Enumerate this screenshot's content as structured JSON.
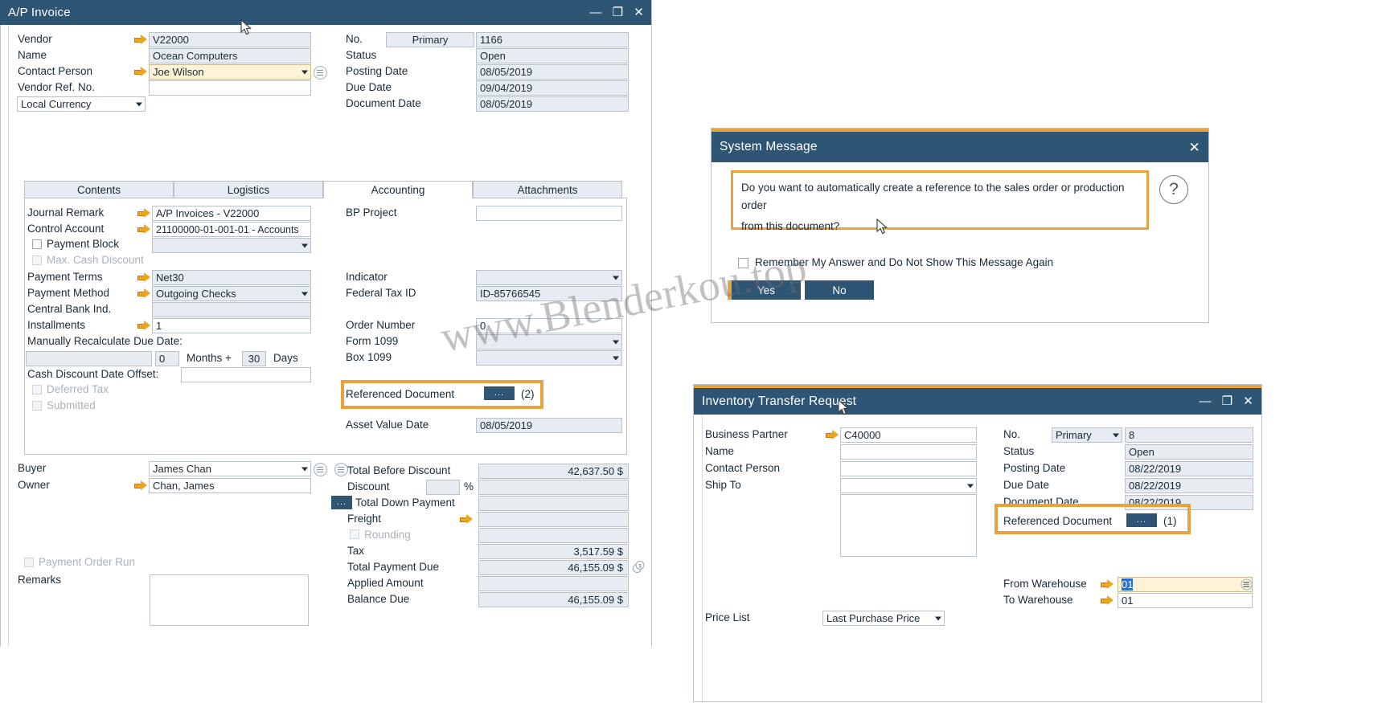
{
  "ap_invoice": {
    "title": "A/P Invoice",
    "window_buttons": {
      "minimize": "—",
      "maximize": "❐",
      "close": "✕"
    },
    "header_left": [
      {
        "label": "Vendor",
        "value": "V22000",
        "arrow": true
      },
      {
        "label": "Name",
        "value": "Ocean Computers",
        "arrow": false
      },
      {
        "label": "Contact Person",
        "value": "Joe Wilson",
        "arrow": true
      },
      {
        "label": "Vendor Ref. No.",
        "value": "",
        "arrow": false
      }
    ],
    "currency_select": "Local Currency",
    "header_right": [
      {
        "label": "No.",
        "series": "Primary",
        "value": "1166"
      },
      {
        "label": "Status",
        "value": "Open"
      },
      {
        "label": "Posting Date",
        "value": "08/05/2019"
      },
      {
        "label": "Due Date",
        "value": "09/04/2019"
      },
      {
        "label": "Document Date",
        "value": "08/05/2019"
      }
    ],
    "tabs": [
      {
        "label": "Contents",
        "active": false
      },
      {
        "label": "Logistics",
        "active": false
      },
      {
        "label": "Accounting",
        "active": true
      },
      {
        "label": "Attachments",
        "active": false
      }
    ],
    "accounting_left": {
      "journal_remark": {
        "label": "Journal Remark",
        "value": "A/P Invoices - V22000"
      },
      "control_account": {
        "label": "Control Account",
        "value": "21100000-01-001-01 - Accounts"
      },
      "payment_block": {
        "label": "Payment Block",
        "value": ""
      },
      "max_cash_discount": {
        "label": "Max. Cash Discount"
      },
      "payment_terms": {
        "label": "Payment Terms",
        "value": "Net30"
      },
      "payment_method": {
        "label": "Payment Method",
        "value": "Outgoing Checks"
      },
      "central_bank_ind": {
        "label": "Central Bank Ind.",
        "value": ""
      },
      "installments": {
        "label": "Installments",
        "value": "1"
      },
      "recalc_label": "Manually Recalculate Due Date:",
      "recalc_base": "",
      "recalc_months": "0",
      "recalc_months_label": "Months +",
      "recalc_days": "30",
      "recalc_days_label": "Days",
      "cash_discount_offset_label": "Cash Discount Date Offset:",
      "cash_discount_offset": "",
      "deferred_tax": "Deferred Tax",
      "submitted": "Submitted"
    },
    "accounting_right": {
      "bp_project": {
        "label": "BP Project",
        "value": ""
      },
      "indicator": {
        "label": "Indicator",
        "value": ""
      },
      "federal_tax_id": {
        "label": "Federal Tax ID",
        "value": "ID-85766545"
      },
      "order_number": {
        "label": "Order Number",
        "value": "0"
      },
      "form_1099": {
        "label": "Form 1099",
        "value": ""
      },
      "box_1099": {
        "label": "Box 1099",
        "value": ""
      },
      "referenced_document": {
        "label": "Referenced Document",
        "button": "...",
        "count": "(2)"
      },
      "asset_value_date": {
        "label": "Asset Value Date",
        "value": "08/05/2019"
      }
    },
    "footer_left": {
      "buyer": {
        "label": "Buyer",
        "value": "James Chan"
      },
      "owner": {
        "label": "Owner",
        "value": "Chan, James"
      },
      "payment_order_run": "Payment Order Run",
      "remarks": {
        "label": "Remarks",
        "value": ""
      }
    },
    "totals": [
      {
        "label": "Total Before Discount",
        "value": "42,637.50 $"
      },
      {
        "label": "Discount",
        "pct_value": "",
        "pct_symbol": "%",
        "value": ""
      },
      {
        "label": "Total Down Payment",
        "value": "",
        "dots": "..."
      },
      {
        "label": "Freight",
        "value": "",
        "arrow": true
      },
      {
        "label": "Rounding",
        "value": "",
        "checkbox": true
      },
      {
        "label": "Tax",
        "value": "3,517.59 $"
      },
      {
        "label": "Total Payment Due",
        "value": "46,155.09 $"
      },
      {
        "label": "Applied Amount",
        "value": ""
      },
      {
        "label": "Balance Due",
        "value": "46,155.09 $"
      }
    ]
  },
  "system_message": {
    "title": "System Message",
    "close": "✕",
    "body_line1": "Do you want to automatically create a reference to the sales order or production order",
    "body_line2": "from this document?",
    "help_icon": "?",
    "remember_checkbox_label": "Remember My Answer and Do Not Show This Message Again",
    "yes_button": "Yes",
    "no_button": "No"
  },
  "inventory_transfer": {
    "title": "Inventory Transfer Request",
    "window_buttons": {
      "minimize": "—",
      "maximize": "❐",
      "close": "✕"
    },
    "left_fields": [
      {
        "label": "Business Partner",
        "value": "C40000",
        "arrow": true
      },
      {
        "label": "Name",
        "value": "",
        "arrow": false
      },
      {
        "label": "Contact Person",
        "value": "",
        "arrow": false
      },
      {
        "label": "Ship To",
        "value": "",
        "arrow": false,
        "dropdown": true
      }
    ],
    "right_fields": [
      {
        "label": "No.",
        "series": "Primary",
        "value": "8"
      },
      {
        "label": "Status",
        "value": "Open"
      },
      {
        "label": "Posting Date",
        "value": "08/22/2019"
      },
      {
        "label": "Due Date",
        "value": "08/22/2019"
      },
      {
        "label": "Document Date",
        "value": "08/22/2019"
      }
    ],
    "referenced_document": {
      "label": "Referenced Document",
      "button": "...",
      "count": "(1)"
    },
    "from_warehouse": {
      "label": "From Warehouse",
      "value": "01"
    },
    "to_warehouse": {
      "label": "To Warehouse",
      "value": "01"
    },
    "price_list": {
      "label": "Price List",
      "value": "Last Purchase Price"
    }
  },
  "watermark": "www.Blenderkou.top",
  "colors": {
    "titlebar": "#2f5574",
    "accent": "#e8a33d",
    "field_bg": "#e6ecf1",
    "border": "#b9c2ca",
    "text": "#1a2a38",
    "selection": "#2a6fc9"
  }
}
